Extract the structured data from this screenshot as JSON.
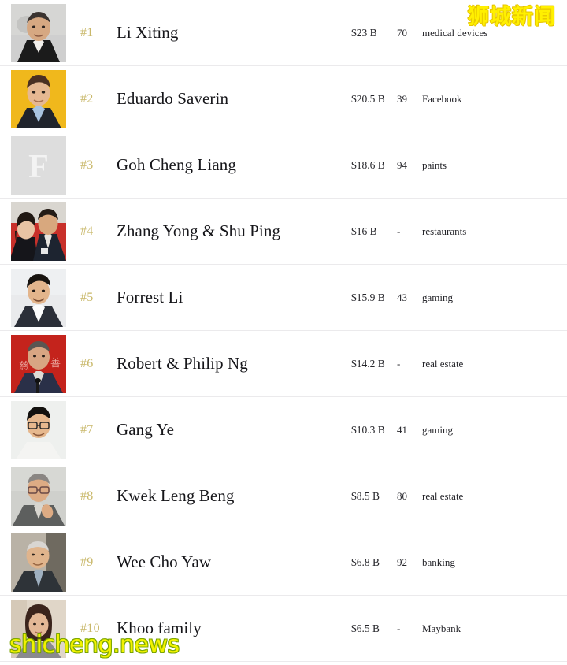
{
  "watermarks": {
    "top_right": "狮城新闻",
    "bottom_left": "shicheng.news",
    "top_color": "#fff000",
    "bottom_color": "#f2f200"
  },
  "colors": {
    "rank": "#c9b86a",
    "name": "#16161a",
    "value": "#25252a",
    "separator": "#ebeaec",
    "background": "#ffffff"
  },
  "rows": [
    {
      "rank": "#1",
      "name": "Li Xiting",
      "net_worth": "$23 B",
      "age": "70",
      "source": "medical devices",
      "avatar": "portrait-man-dark-suit-grey-bg"
    },
    {
      "rank": "#2",
      "name": "Eduardo Saverin",
      "net_worth": "$20.5 B",
      "age": "39",
      "source": "Facebook",
      "avatar": "portrait-man-yellow-bg"
    },
    {
      "rank": "#3",
      "name": "Goh Cheng Liang",
      "net_worth": "$18.6 B",
      "age": "94",
      "source": "paints",
      "avatar": "placeholder-letter-f"
    },
    {
      "rank": "#4",
      "name": "Zhang Yong & Shu Ping",
      "net_worth": "$16 B",
      "age": "-",
      "source": "restaurants",
      "avatar": "portrait-couple-red-bg"
    },
    {
      "rank": "#5",
      "name": "Forrest Li",
      "net_worth": "$15.9 B",
      "age": "43",
      "source": "gaming",
      "avatar": "portrait-man-light-bg"
    },
    {
      "rank": "#6",
      "name": "Robert & Philip Ng",
      "net_worth": "$14.2 B",
      "age": "-",
      "source": "real estate",
      "avatar": "portrait-man-podium-red-bg"
    },
    {
      "rank": "#7",
      "name": "Gang Ye",
      "net_worth": "$10.3 B",
      "age": "41",
      "source": "gaming",
      "avatar": "portrait-man-glasses-light-bg"
    },
    {
      "rank": "#8",
      "name": "Kwek Leng Beng",
      "net_worth": "$8.5 B",
      "age": "80",
      "source": "real estate",
      "avatar": "portrait-man-glasses-grey-bg"
    },
    {
      "rank": "#9",
      "name": "Wee Cho Yaw",
      "net_worth": "$6.8 B",
      "age": "92",
      "source": "banking",
      "avatar": "portrait-elderly-man-suit"
    },
    {
      "rank": "#10",
      "name": "Khoo family",
      "net_worth": "$6.5 B",
      "age": "-",
      "source": "Maybank",
      "avatar": "portrait-woman-bob-hair"
    }
  ],
  "placeholder_letter": "F"
}
